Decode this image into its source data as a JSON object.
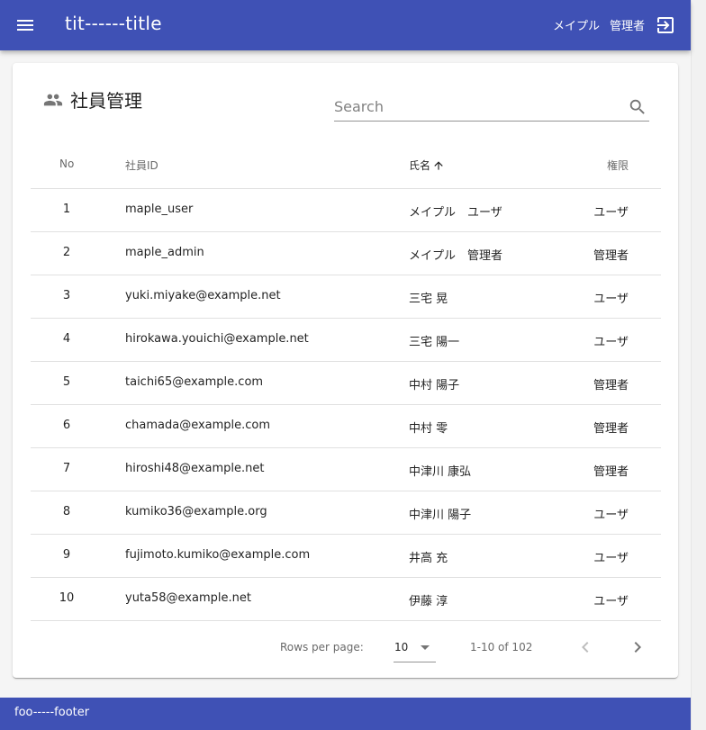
{
  "header": {
    "title": "tit------title",
    "user_name": "メイプル",
    "user_role": "管理者"
  },
  "card": {
    "title": "社員管理",
    "search": {
      "placeholder": "Search",
      "value": ""
    }
  },
  "table": {
    "columns": {
      "no": "No",
      "id": "社員ID",
      "name": "氏名",
      "role": "権限"
    },
    "rows": [
      {
        "no": "1",
        "id": "maple_user",
        "name": "メイプル　ユーザ",
        "role": "ユーザ"
      },
      {
        "no": "2",
        "id": "maple_admin",
        "name": "メイプル　管理者",
        "role": "管理者"
      },
      {
        "no": "3",
        "id": "yuki.miyake@example.net",
        "name": "三宅 晃",
        "role": "ユーザ"
      },
      {
        "no": "4",
        "id": "hirokawa.youichi@example.net",
        "name": "三宅 陽一",
        "role": "ユーザ"
      },
      {
        "no": "5",
        "id": "taichi65@example.com",
        "name": "中村 陽子",
        "role": "管理者"
      },
      {
        "no": "6",
        "id": "chamada@example.com",
        "name": "中村 零",
        "role": "管理者"
      },
      {
        "no": "7",
        "id": "hiroshi48@example.net",
        "name": "中津川 康弘",
        "role": "管理者"
      },
      {
        "no": "8",
        "id": "kumiko36@example.org",
        "name": "中津川 陽子",
        "role": "ユーザ"
      },
      {
        "no": "9",
        "id": "fujimoto.kumiko@example.com",
        "name": "井高 充",
        "role": "ユーザ"
      },
      {
        "no": "10",
        "id": "yuta58@example.net",
        "name": "伊藤 淳",
        "role": "ユーザ"
      }
    ]
  },
  "pagination": {
    "rows_per_page_label": "Rows per page:",
    "rows_per_page": "10",
    "range": "1-10 of 102"
  },
  "footer": {
    "text": "foo-----footer"
  },
  "colors": {
    "primary": "#3f51b5",
    "background": "#f5f5f5"
  }
}
